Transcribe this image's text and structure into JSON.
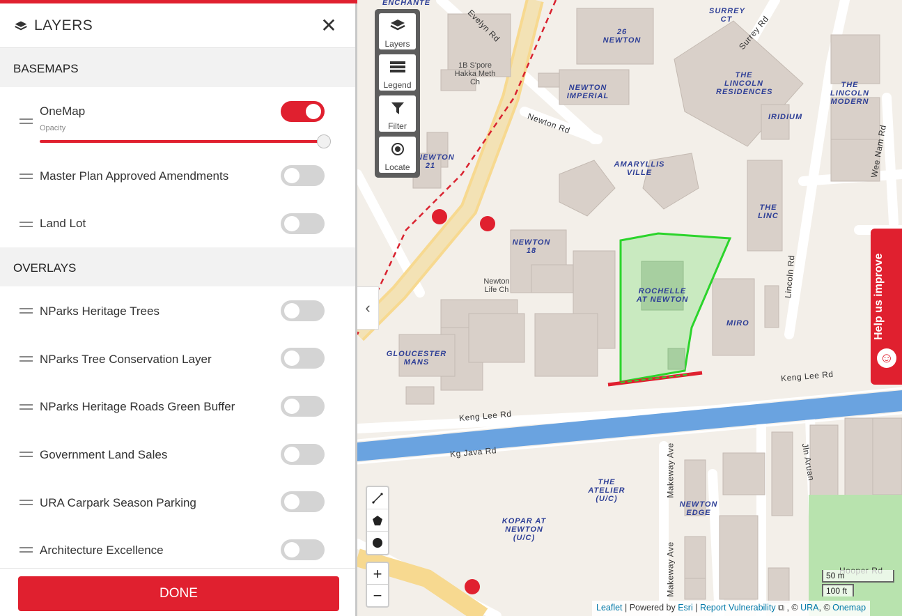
{
  "panel": {
    "title": "LAYERS",
    "close_symbol": "✕",
    "basemaps_heading": "BASEMAPS",
    "overlays_heading": "OVERLAYS",
    "opacity_label": "Opacity",
    "opacity_value": 1.0,
    "done_label": "DONE",
    "basemaps": [
      {
        "label": "OneMap",
        "enabled": true
      },
      {
        "label": "Master Plan Approved Amendments",
        "enabled": false
      },
      {
        "label": "Land Lot",
        "enabled": false
      }
    ],
    "overlays": [
      {
        "label": "NParks Heritage Trees",
        "enabled": false
      },
      {
        "label": "NParks Tree Conservation Layer",
        "enabled": false
      },
      {
        "label": "NParks Heritage Roads Green Buffer",
        "enabled": false
      },
      {
        "label": "Government Land Sales",
        "enabled": false
      },
      {
        "label": "URA Carpark Season Parking",
        "enabled": false
      },
      {
        "label": "Architecture Excellence",
        "enabled": false
      }
    ]
  },
  "map_tools": {
    "layers": "Layers",
    "legend": "Legend",
    "filter": "Filter",
    "locate": "Locate"
  },
  "zoom": {
    "in": "+",
    "out": "−"
  },
  "help_tab": "Help us improve",
  "scale": {
    "metric": "50 m",
    "imperial": "100 ft"
  },
  "attribution": {
    "leaflet": "Leaflet",
    "powered_by": " | Powered by ",
    "esri": "Esri",
    "sep": " | ",
    "report": "Report Vulnerability",
    "tail": " , © ",
    "ura": "URA",
    "tail2": ", © ",
    "onemap": "Onemap"
  },
  "map_labels": {
    "places": [
      "ENCHANTE",
      "SURREY CT",
      "26 NEWTON",
      "NEWTON IMPERIAL",
      "THE LINCOLN RESIDENCES",
      "THE LINCOLN MODERN",
      "IRIDIUM",
      "AMARYLLIS VILLE",
      "NEWTON 21",
      "NEWTON 18",
      "THE LINC",
      "ROCHELLE AT NEWTON",
      "MIRO",
      "GLOUCESTER MANS",
      "THE ATELIER (U/C)",
      "KOPAR AT NEWTON (U/C)",
      "NEWTON EDGE"
    ],
    "roads": [
      "Evelyn Rd",
      "Surrey Rd",
      "Newton Rd",
      "Wee Nam Rd",
      "Lincoln Rd",
      "Keng Lee Rd",
      "Keng Lee Rd",
      "Kg Java Rd",
      "Makeway Ave",
      "Makeway Ave",
      "Jln Aruan",
      "Hooper Rd"
    ],
    "other": [
      "1B S'pore Hakka Meth Ch",
      "Newton Life Ch"
    ]
  }
}
